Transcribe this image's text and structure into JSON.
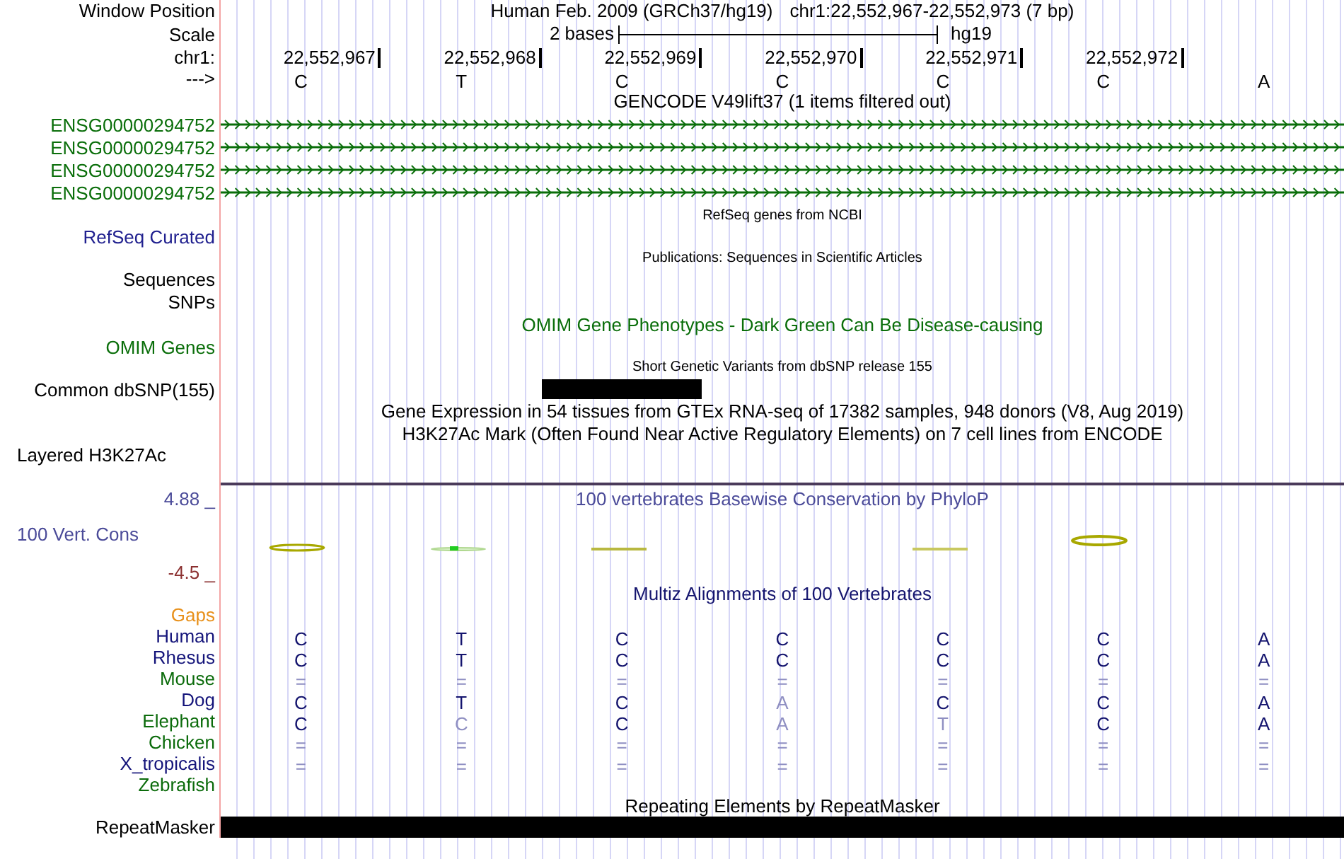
{
  "header": {
    "label": "Window Position",
    "assembly": "Human Feb. 2009 (GRCh37/hg19)",
    "position": "chr1:22,552,967-22,552,973 (7 bp)"
  },
  "scale": {
    "label": "Scale",
    "text": "2 bases",
    "assembly": "hg19"
  },
  "ruler": {
    "label": "chr1:",
    "positions": [
      "22,552,967",
      "22,552,968",
      "22,552,969",
      "22,552,970",
      "22,552,971",
      "22,552,972"
    ]
  },
  "sequence": {
    "label": "--->",
    "bases": [
      "C",
      "T",
      "C",
      "C",
      "C",
      "C",
      "A"
    ]
  },
  "gencode": {
    "title": "GENCODE V49lift37 (1 items filtered out)",
    "genes": [
      {
        "name": "ENSG00000294752"
      },
      {
        "name": "ENSG00000294752"
      },
      {
        "name": "ENSG00000294752"
      },
      {
        "name": "ENSG00000294752"
      }
    ]
  },
  "refseq": {
    "title": "RefSeq genes from NCBI",
    "label": "RefSeq Curated"
  },
  "publications": {
    "title": "Publications: Sequences in Scientific Articles",
    "labels": [
      "Sequences",
      "SNPs"
    ]
  },
  "omim": {
    "title": "OMIM Gene Phenotypes - Dark Green Can Be Disease-causing",
    "label": "OMIM Genes"
  },
  "dbsnp": {
    "title": "Short Genetic Variants from dbSNP release 155",
    "label": "Common dbSNP(155)",
    "sites": [
      {
        "variant": false
      },
      {
        "variant": false
      },
      {
        "variant": true
      },
      {
        "variant": false
      },
      {
        "variant": false
      },
      {
        "variant": false
      },
      {
        "variant": false
      }
    ]
  },
  "gtex": {
    "title": "Gene Expression in 54 tissues from GTEx RNA-seq of 17382 samples, 948 donors (V8, Aug 2019)"
  },
  "h3k27ac": {
    "title": "H3K27Ac Mark (Often Found Near Active Regulatory Elements) on 7 cell lines from ENCODE",
    "label": "Layered H3K27Ac"
  },
  "phylop": {
    "title": "100 vertebrates Basewise Conservation by PhyloP",
    "label": "100 Vert. Cons",
    "max_label": "4.88 _",
    "min_label": "-4.5 _"
  },
  "multiz": {
    "title": "Multiz Alignments of 100 Vertebrates",
    "gaps_label": "Gaps",
    "species": [
      {
        "name": "Human",
        "color": "#14147a",
        "bases": [
          {
            "base": "C",
            "faded": false
          },
          {
            "base": "T",
            "faded": false
          },
          {
            "base": "C",
            "faded": false
          },
          {
            "base": "C",
            "faded": false
          },
          {
            "base": "C",
            "faded": false
          },
          {
            "base": "C",
            "faded": false
          },
          {
            "base": "A",
            "faded": false
          }
        ]
      },
      {
        "name": "Rhesus",
        "color": "#14147a",
        "bases": [
          {
            "base": "C",
            "faded": false
          },
          {
            "base": "T",
            "faded": false
          },
          {
            "base": "C",
            "faded": false
          },
          {
            "base": "C",
            "faded": false
          },
          {
            "base": "C",
            "faded": false
          },
          {
            "base": "C",
            "faded": false
          },
          {
            "base": "A",
            "faded": false
          }
        ]
      },
      {
        "name": "Mouse",
        "color": "#0b6b0b",
        "bases": [
          {
            "base": "=",
            "faded": true
          },
          {
            "base": "=",
            "faded": true
          },
          {
            "base": "=",
            "faded": true
          },
          {
            "base": "=",
            "faded": true
          },
          {
            "base": "=",
            "faded": true
          },
          {
            "base": "=",
            "faded": true
          },
          {
            "base": "=",
            "faded": true
          }
        ]
      },
      {
        "name": "Dog",
        "color": "#14147a",
        "bases": [
          {
            "base": "C",
            "faded": false
          },
          {
            "base": "T",
            "faded": false
          },
          {
            "base": "C",
            "faded": false
          },
          {
            "base": "A",
            "faded": true
          },
          {
            "base": "C",
            "faded": false
          },
          {
            "base": "C",
            "faded": false
          },
          {
            "base": "A",
            "faded": false
          }
        ]
      },
      {
        "name": "Elephant",
        "color": "#0b6b0b",
        "bases": [
          {
            "base": "C",
            "faded": false
          },
          {
            "base": "C",
            "faded": true
          },
          {
            "base": "C",
            "faded": false
          },
          {
            "base": "A",
            "faded": true
          },
          {
            "base": "T",
            "faded": true
          },
          {
            "base": "C",
            "faded": false
          },
          {
            "base": "A",
            "faded": false
          }
        ]
      },
      {
        "name": "Chicken",
        "color": "#0b6b0b",
        "bases": [
          {
            "base": "=",
            "faded": true
          },
          {
            "base": "=",
            "faded": true
          },
          {
            "base": "=",
            "faded": true
          },
          {
            "base": "=",
            "faded": true
          },
          {
            "base": "=",
            "faded": true
          },
          {
            "base": "=",
            "faded": true
          },
          {
            "base": "=",
            "faded": true
          }
        ]
      },
      {
        "name": "X_tropicalis",
        "color": "#14147a",
        "bases": [
          {
            "base": "=",
            "faded": true
          },
          {
            "base": "=",
            "faded": true
          },
          {
            "base": "=",
            "faded": true
          },
          {
            "base": "=",
            "faded": true
          },
          {
            "base": "=",
            "faded": true
          },
          {
            "base": "=",
            "faded": true
          },
          {
            "base": "=",
            "faded": true
          }
        ]
      },
      {
        "name": "Zebrafish",
        "color": "#0b6b0b"
      }
    ]
  },
  "repeatmasker": {
    "title": "Repeating Elements by RepeatMasker",
    "label": "RepeatMasker"
  }
}
